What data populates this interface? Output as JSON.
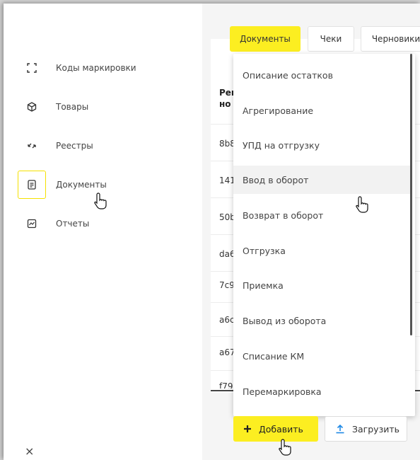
{
  "sidebar": {
    "items": [
      {
        "label": "Коды маркировки",
        "icon": "scan-frame-icon",
        "active": false
      },
      {
        "label": "Товары",
        "icon": "box-icon",
        "active": false
      },
      {
        "label": "Реестры",
        "icon": "transfer-arrows-icon",
        "active": false
      },
      {
        "label": "Документы",
        "icon": "document-icon",
        "active": true
      },
      {
        "label": "Отчеты",
        "icon": "chart-icon",
        "active": false
      }
    ],
    "close_label": "×"
  },
  "tabs": [
    {
      "label": "Документы",
      "active": true
    },
    {
      "label": "Чеки",
      "active": false
    },
    {
      "label": "Черновики",
      "active": false
    }
  ],
  "table": {
    "header_line1": "Рег",
    "header_line2": "но",
    "rows": [
      "8b8",
      "141",
      "50b",
      "da6",
      "7c9",
      "a6c",
      "a67",
      "f79"
    ]
  },
  "dropdown": {
    "items": [
      "Описание остатков",
      "Агрегирование",
      "УПД на отгрузку",
      "Ввод в оборот",
      "Возврат в оборот",
      "Отгрузка",
      "Приемка",
      "Вывод из оборота",
      "Списание КМ",
      "Перемаркировка"
    ],
    "hover_index": 3
  },
  "buttons": {
    "add_label": "Добавить",
    "upload_label": "Загрузить"
  },
  "colors": {
    "accent": "#fcee21",
    "active_border": "#f5e100",
    "upload_icon": "#1e88e5"
  }
}
